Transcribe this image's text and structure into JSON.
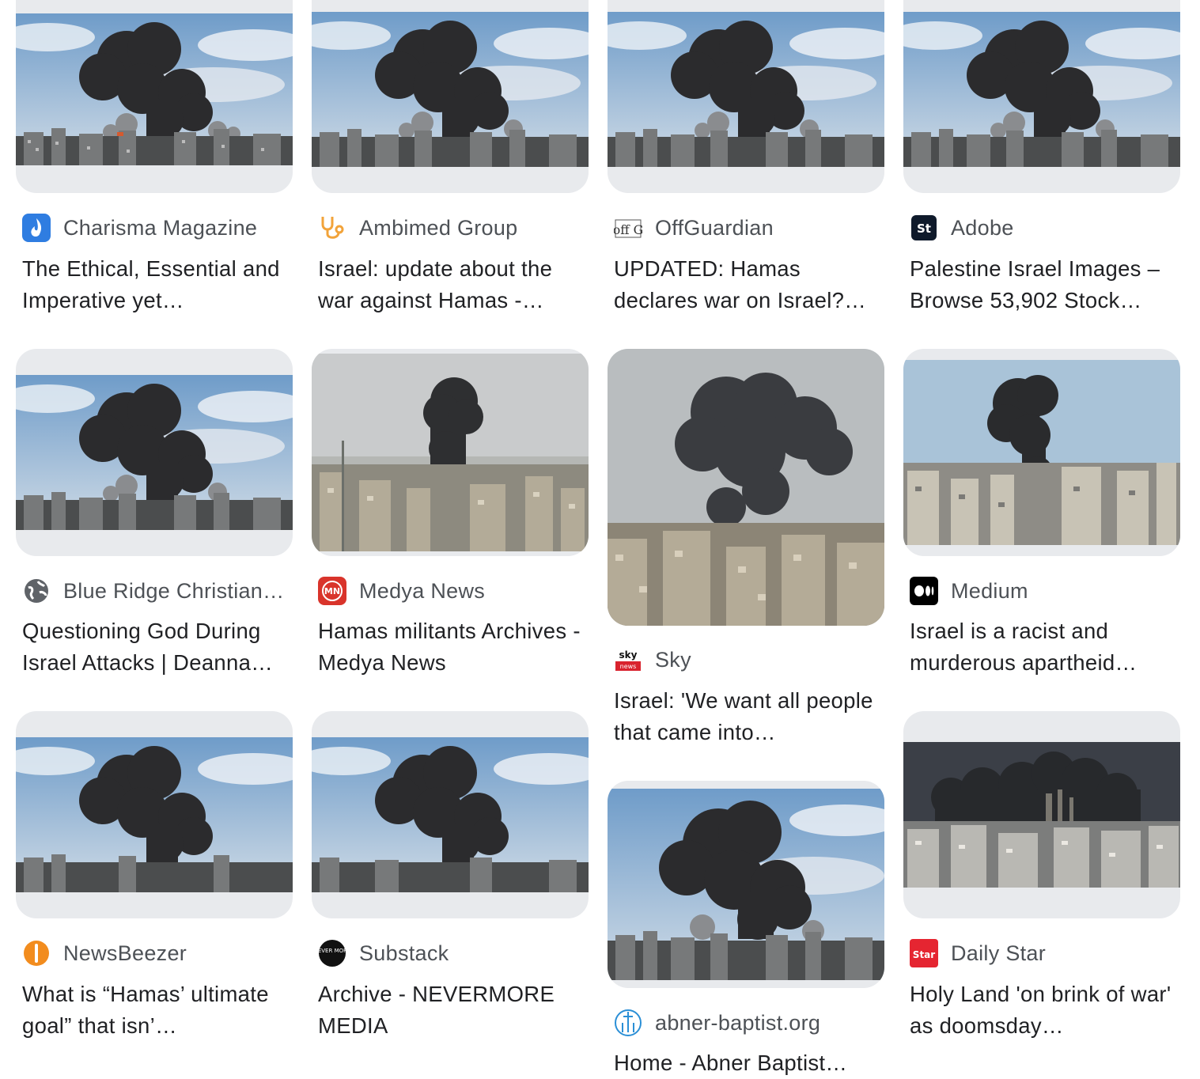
{
  "results": [
    {
      "source": "Charisma Magazine",
      "title": "The Ethical, Essential and Imperative yet…",
      "favicon": "flame-icon",
      "image": "smoke-plume-a"
    },
    {
      "source": "Ambimed Group",
      "title": "Israel: update about the war against Hamas -…",
      "favicon": "stethoscope-icon",
      "image": "smoke-plume-a"
    },
    {
      "source": "OffGuardian",
      "title": "UPDATED: Hamas declares war on Israel?…",
      "favicon": "offguardian-logo-icon",
      "image": "smoke-plume-a"
    },
    {
      "source": "Adobe",
      "title": "Palestine Israel Images – Browse 53,902 Stock…",
      "favicon": "adobe-stock-icon",
      "image": "smoke-plume-a"
    },
    {
      "source": "Blue Ridge Christian…",
      "title": "Questioning God During Israel Attacks | Deanna…",
      "favicon": "globe-icon",
      "image": "smoke-plume-a"
    },
    {
      "source": "Medya News",
      "title": "Hamas militants Archives - Medya News",
      "favicon": "medya-news-icon",
      "image": "smoke-column-b"
    },
    {
      "source": "Sky",
      "title": "Israel: 'We want all people that came into…",
      "favicon": "sky-news-icon",
      "image": "smoke-cloud-c"
    },
    {
      "source": "Medium",
      "title": "Israel is a racist and murderous apartheid…",
      "favicon": "medium-icon",
      "image": "smoke-column-d"
    },
    {
      "source": "NewsBeezer",
      "title": "What is “Hamas’ ultimate goal” that isn’…",
      "favicon": "newsbeezer-icon",
      "image": "smoke-plume-a"
    },
    {
      "source": "Substack",
      "title": "Archive - NEVERMORE MEDIA",
      "favicon": "nevermore-icon",
      "image": "smoke-plume-a"
    },
    {
      "source": "abner-baptist.org",
      "title": "Home - Abner Baptist…",
      "favicon": "church-icon",
      "image": "smoke-plume-a"
    },
    {
      "source": "Daily Star",
      "title": "Holy Land 'on brink of war' as doomsday…",
      "favicon": "daily-star-icon",
      "image": "smoke-wide-e"
    }
  ],
  "favicon_texts": {
    "adobe": "St",
    "medya": "MN",
    "sky_top": "sky",
    "sky_bottom": "news",
    "daily_star": "Star",
    "nevermore": "NEVER MORE",
    "offguardian": "off G"
  }
}
